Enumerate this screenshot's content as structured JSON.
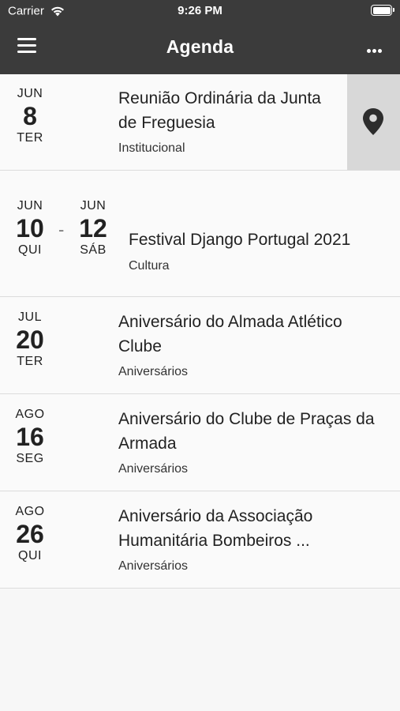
{
  "status_bar": {
    "carrier": "Carrier",
    "time": "9:26 PM"
  },
  "navbar": {
    "title": "Agenda",
    "menu_icon": "hamburger-menu-icon",
    "more_icon": "more-horizontal-icon"
  },
  "events": [
    {
      "start": {
        "month": "JUN",
        "day": "8",
        "weekday": "TER"
      },
      "title": "Reunião Ordinária da Junta de Freguesia",
      "category": "Institucional",
      "map_icon": "map-pin-icon"
    },
    {
      "start": {
        "month": "JUN",
        "day": "10",
        "weekday": "QUI"
      },
      "end": {
        "month": "JUN",
        "day": "12",
        "weekday": "SÁB"
      },
      "separator": "-",
      "title": "Festival Django Portugal 2021",
      "category": "Cultura"
    },
    {
      "start": {
        "month": "JUL",
        "day": "20",
        "weekday": "TER"
      },
      "title": "Aniversário do Almada Atlético Clube",
      "category": "Aniversários"
    },
    {
      "start": {
        "month": "AGO",
        "day": "16",
        "weekday": "SEG"
      },
      "title": "Aniversário do Clube de Praças da Armada",
      "category": "Aniversários"
    },
    {
      "start": {
        "month": "AGO",
        "day": "26",
        "weekday": "QUI"
      },
      "title": "Aniversário da Associação Humanitária Bombeiros ...",
      "category": "Aniversários"
    }
  ],
  "colors": {
    "header_bg": "#3b3b3b",
    "page_bg": "#f7f7f7",
    "map_button_bg": "#d8d8d8"
  }
}
